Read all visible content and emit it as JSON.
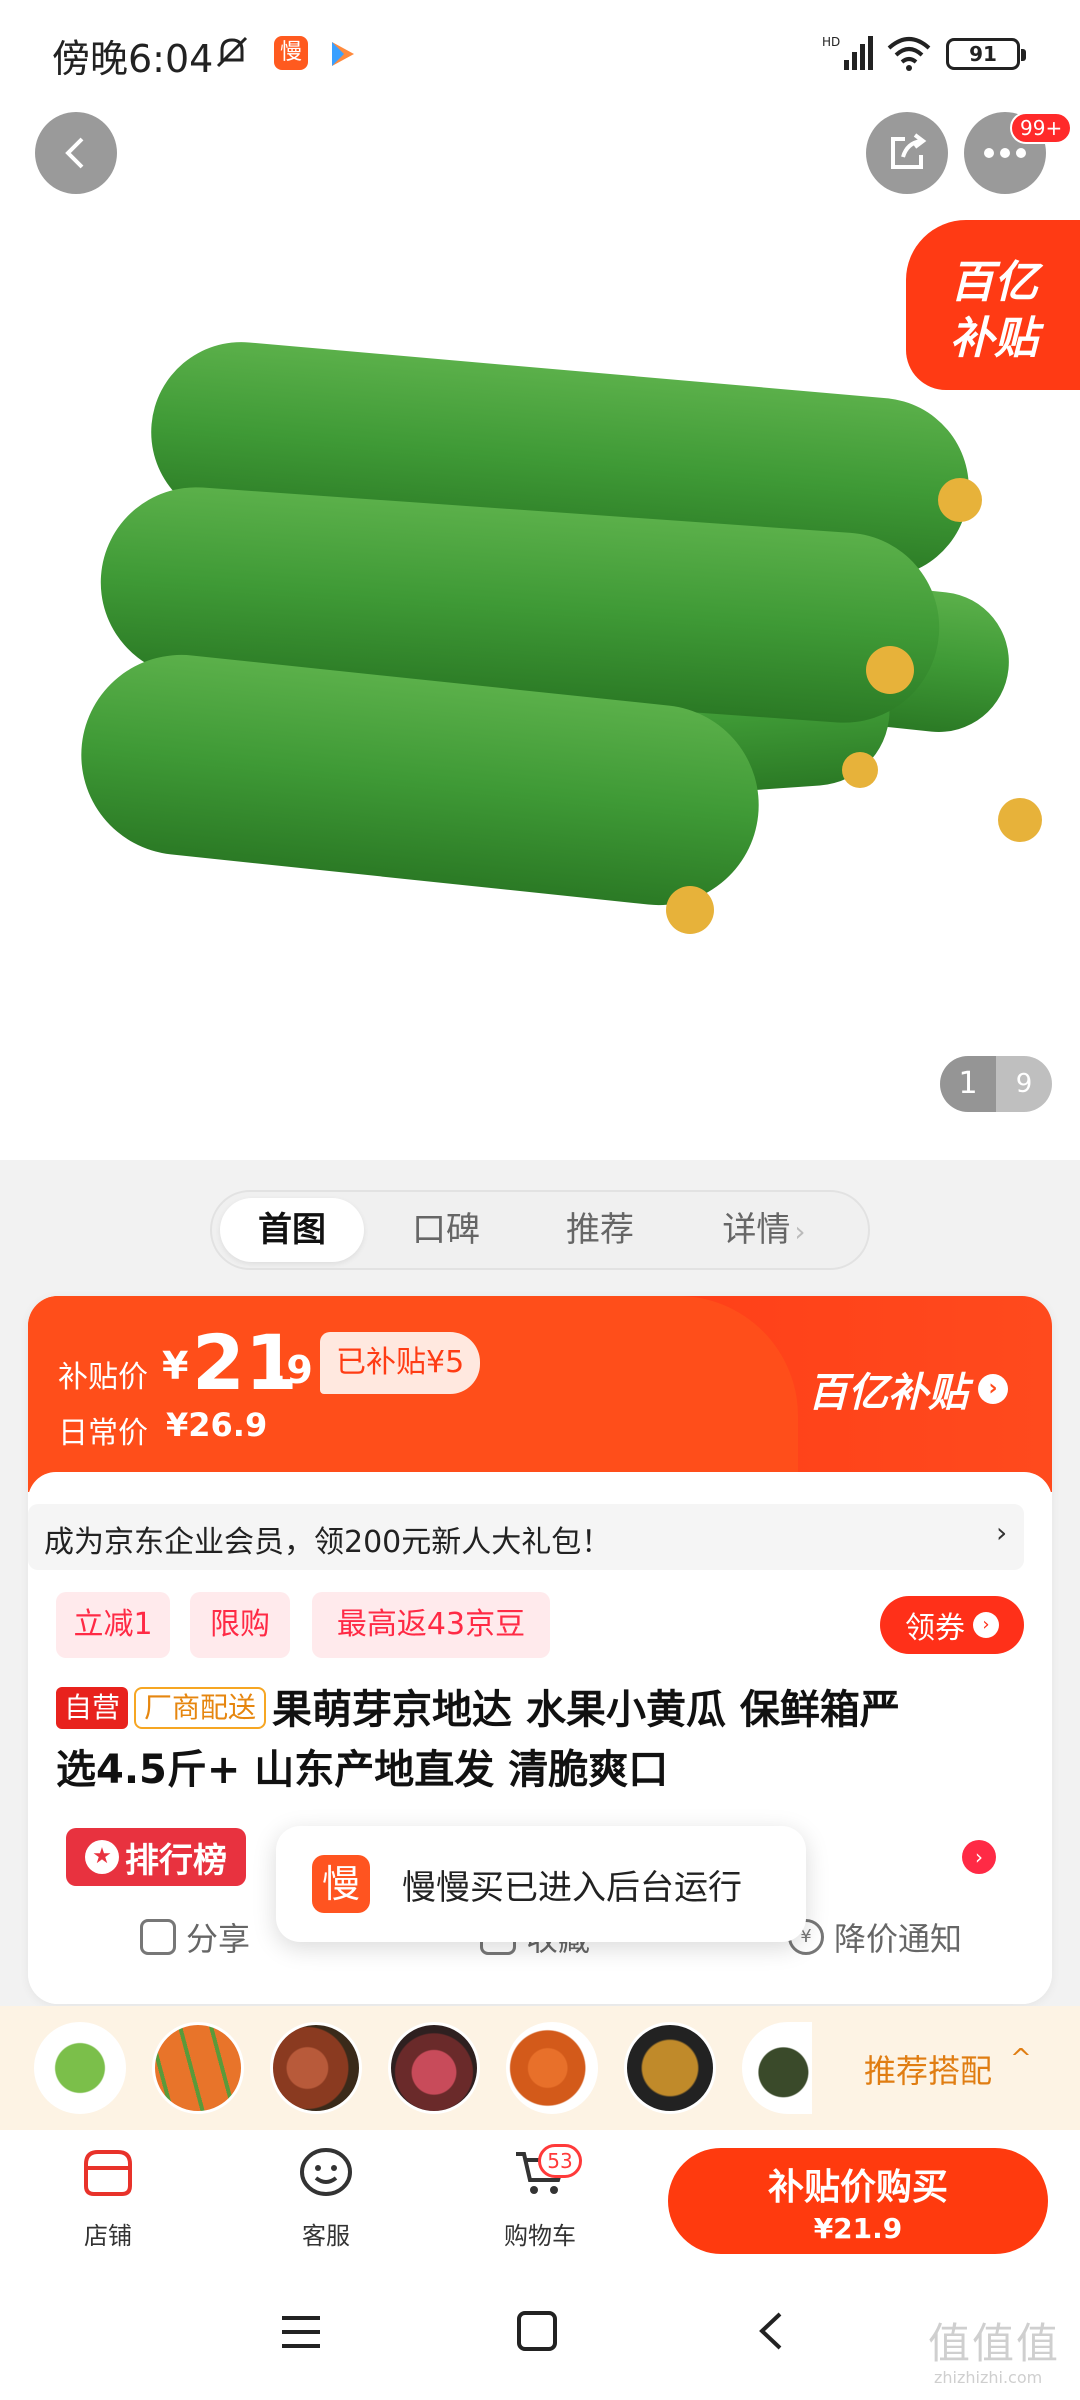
{
  "status_bar": {
    "time": "傍晚6:04",
    "mini_app_glyph": "慢",
    "battery": "91",
    "network_label": "HD"
  },
  "header": {
    "more_badge": "99+"
  },
  "hero": {
    "corner_line1": "百亿",
    "corner_line2": "补贴",
    "image_index": "1",
    "image_total": "9"
  },
  "tabs": [
    {
      "label": "首图",
      "active": true
    },
    {
      "label": "口碑"
    },
    {
      "label": "推荐"
    },
    {
      "label": "详情"
    }
  ],
  "price": {
    "subsidy_label": "补贴价",
    "currency": "¥",
    "integer": "21",
    "decimal": ".9",
    "subsidy_tag": "已补贴¥5",
    "daily_label": "日常价",
    "daily_price": "¥26.9",
    "brand": "百亿补贴"
  },
  "member": {
    "text": "成为京东企业会员，领200元新人大礼包！",
    "arrow": "›"
  },
  "promo_chips": [
    {
      "label": "立减1"
    },
    {
      "label": "限购"
    },
    {
      "label": "最高返43京豆"
    }
  ],
  "coupon_label": "领券",
  "product": {
    "tag_self": "自营",
    "tag_factory": "厂商配送",
    "title_line1": "果萌芽京地达 水果小黄瓜 保鲜箱严",
    "title_line2": "选4.5斤+ 山东产地直发 清脆爽口"
  },
  "rank": {
    "label": "排行榜"
  },
  "actions": {
    "share": "分享",
    "favorite": "收藏",
    "price_alert": "降价通知"
  },
  "toast": {
    "logo": "慢",
    "message": "慢慢买已进入后台运行"
  },
  "recommend": {
    "label": "推荐搭配",
    "caret": "^"
  },
  "bottom_nav": {
    "shop": "店铺",
    "service": "客服",
    "cart": "购物车",
    "cart_count": "53"
  },
  "buy_button": {
    "line1": "补贴价购买",
    "line2": "¥21.9"
  },
  "watermark": {
    "main": "值值值",
    "sub": "zhizhizhi.com"
  },
  "colors": {
    "accent": "#ff3a0e",
    "subsidy_orange": "#ff4e1a",
    "chip_red": "#ff2a45",
    "recommend_text": "#e07d12"
  }
}
